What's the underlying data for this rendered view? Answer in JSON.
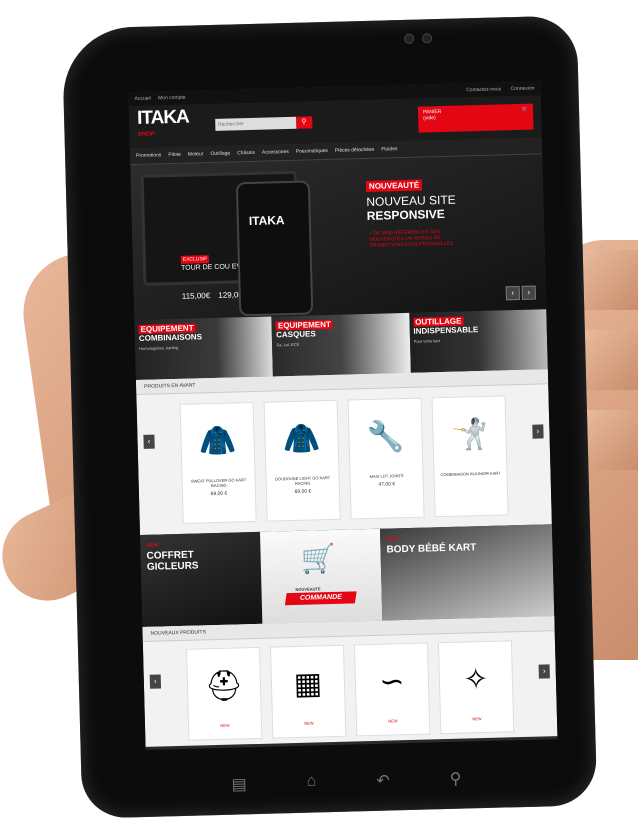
{
  "topbar": {
    "left": [
      "Accueil",
      "Mon compte"
    ],
    "right": [
      "Contactez-nous",
      "Connexion"
    ]
  },
  "header": {
    "logo": "ITAKA",
    "logo_sub": "SHOP",
    "search_placeholder": "Rechercher",
    "search_icon": "search-icon",
    "cart_label": "PANIER",
    "cart_sub": "(vide)",
    "cart_icon": "cart-icon"
  },
  "nav": [
    "Promotions",
    "Pilote",
    "Moteur",
    "Outillage",
    "Châssis",
    "Accessoires",
    "Pneumatiques",
    "Pièces détachées",
    "Fluides",
    "Vêtements"
  ],
  "hero": {
    "phone_logo": "ITAKA",
    "exclu": "EXCLUSIF",
    "exclu_text": "TOUR DE COU EVS",
    "prices": [
      "115,00€",
      "129,00€"
    ],
    "badge": "NOUVEAUTÉ",
    "title1": "NOUVEAU SITE",
    "title2": "RESPONSIVE",
    "sub": "+ DE 8000 RÉFÉRENCES DES NOUVEAUTÉS UN NIVEAU DE PROMOTIONS EXCEPTIONNELLES",
    "prev": "‹",
    "next": "›"
  },
  "categories": [
    {
      "title": "EQUIPEMENT",
      "title2": "COMBINAISONS",
      "sub": "Homologuées, karting"
    },
    {
      "title": "EQUIPEMENT",
      "title2": "CASQUES",
      "sub": "Sa, Lol, ECE"
    },
    {
      "title": "OUTILLAGE",
      "title2": "INDISPENSABLE",
      "sub": "Pour votre kart"
    }
  ],
  "featured": {
    "title": "PRODUITS EN AVANT",
    "items": [
      {
        "name": "SWEAT PULLOVER GO KART RACING",
        "price": "69,00 €",
        "old": "",
        "icon": "jacket-icon"
      },
      {
        "name": "DOUDOUNE LIGHT GO KART RACING",
        "price": "69,00 €",
        "old": "",
        "icon": "jacket-icon"
      },
      {
        "name": "MAXI LOT JOINTS",
        "price": "47,00 €",
        "old": "",
        "icon": "parts-kit-icon"
      },
      {
        "name": "COMBINAISON INJUNIOR KART",
        "price": "",
        "old": "",
        "icon": "race-suit-icon"
      }
    ]
  },
  "promos": {
    "left_new": "NEW",
    "left_title": "COFFRET GICLEURS",
    "middle_top": "NOUVEAUTE",
    "middle_btn": "COMMANDE",
    "right_new": "NEW",
    "right_title": "BODY BÉBÉ KART"
  },
  "new_products": {
    "title": "NOUVEAUX PRODUITS",
    "badge": "NEW",
    "items": [
      {
        "icon": "helmet-icon"
      },
      {
        "icon": "radiator-icon"
      },
      {
        "icon": "cable-icon"
      },
      {
        "icon": "neck-protector-icon"
      }
    ]
  },
  "softkeys": [
    "menu-key-icon",
    "home-key-icon",
    "back-key-icon",
    "search-key-icon"
  ],
  "colors": {
    "accent": "#e30613",
    "dark": "#1b1b1b",
    "light": "#f2f2f2"
  }
}
